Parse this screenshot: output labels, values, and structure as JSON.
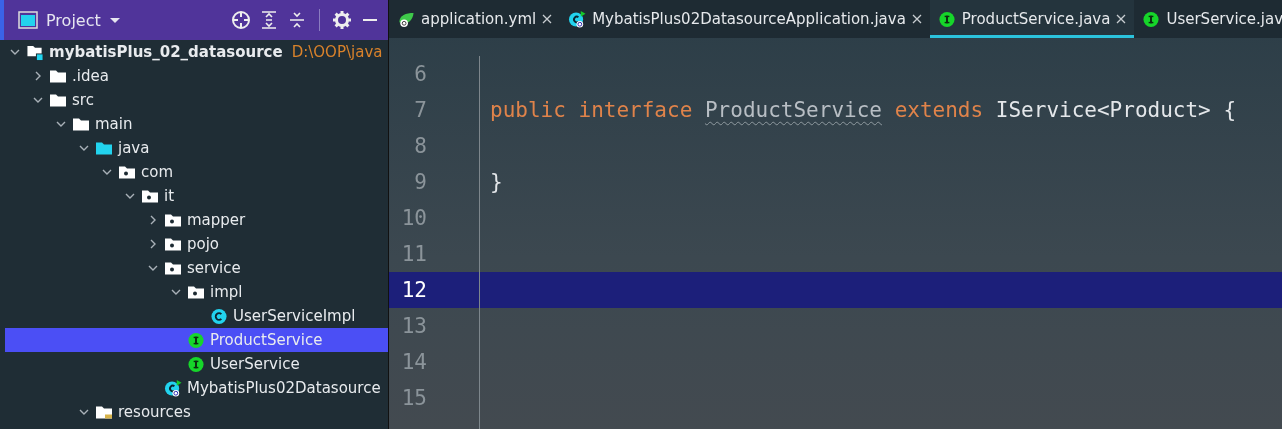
{
  "project_panel": {
    "title": "Project",
    "tree": [
      {
        "label": "mybatisPlus_02_datasource",
        "kind": "module",
        "path": "D:\\OOP\\java",
        "expanded": true,
        "selected": false,
        "children": [
          {
            "label": ".idea",
            "kind": "folder",
            "expanded": false,
            "selected": false
          },
          {
            "label": "src",
            "kind": "folder",
            "expanded": true,
            "selected": false,
            "children": [
              {
                "label": "main",
                "kind": "folder",
                "expanded": true,
                "selected": false,
                "children": [
                  {
                    "label": "java",
                    "kind": "source-folder",
                    "expanded": true,
                    "selected": false,
                    "children": [
                      {
                        "label": "com",
                        "kind": "package",
                        "expanded": true,
                        "selected": false,
                        "children": [
                          {
                            "label": "it",
                            "kind": "package",
                            "expanded": true,
                            "selected": false,
                            "children": [
                              {
                                "label": "mapper",
                                "kind": "package",
                                "expanded": false,
                                "selected": false
                              },
                              {
                                "label": "pojo",
                                "kind": "package",
                                "expanded": false,
                                "selected": false
                              },
                              {
                                "label": "service",
                                "kind": "package",
                                "expanded": true,
                                "selected": false,
                                "children": [
                                  {
                                    "label": "impl",
                                    "kind": "package",
                                    "expanded": true,
                                    "selected": false,
                                    "children": [
                                      {
                                        "label": "UserServiceImpl",
                                        "kind": "class",
                                        "selected": false
                                      }
                                    ]
                                  },
                                  {
                                    "label": "ProductService",
                                    "kind": "interface",
                                    "selected": true
                                  },
                                  {
                                    "label": "UserService",
                                    "kind": "interface",
                                    "selected": false
                                  }
                                ]
                              },
                              {
                                "label": "MybatisPlus02Datasource",
                                "kind": "app-class",
                                "selected": false
                              }
                            ]
                          }
                        ]
                      }
                    ]
                  },
                  {
                    "label": "resources",
                    "kind": "resources-folder",
                    "expanded": true,
                    "selected": false
                  }
                ]
              }
            ]
          }
        ]
      }
    ]
  },
  "editor": {
    "tabs": [
      {
        "label": "application.yml",
        "kind": "yml",
        "selected": false,
        "closable": true
      },
      {
        "label": "MybatisPlus02DatasourceApplication.java",
        "kind": "app-class",
        "selected": false,
        "closable": true
      },
      {
        "label": "ProductService.java",
        "kind": "interface",
        "selected": true,
        "closable": true
      },
      {
        "label": "UserService.jav",
        "kind": "interface",
        "selected": false,
        "closable": false
      }
    ],
    "lines": [
      {
        "number": "6",
        "current": false
      },
      {
        "number": "7",
        "current": false,
        "tokens": [
          {
            "text": "public",
            "kind": "keyword"
          },
          {
            "text": "interface",
            "kind": "keyword"
          },
          {
            "text": "ProductService",
            "kind": "warned"
          },
          {
            "text": "extends",
            "kind": "keyword"
          },
          {
            "text": "IService<Product>",
            "kind": "plain"
          },
          {
            "text": "{",
            "kind": "plain"
          }
        ]
      },
      {
        "number": "8",
        "current": false
      },
      {
        "number": "9",
        "current": false,
        "tokens": [
          {
            "text": "}",
            "kind": "plain"
          }
        ]
      },
      {
        "number": "10",
        "current": false
      },
      {
        "number": "11",
        "current": false
      },
      {
        "number": "12",
        "current": true
      },
      {
        "number": "13",
        "current": false
      },
      {
        "number": "14",
        "current": false
      },
      {
        "number": "15",
        "current": false
      }
    ]
  }
}
